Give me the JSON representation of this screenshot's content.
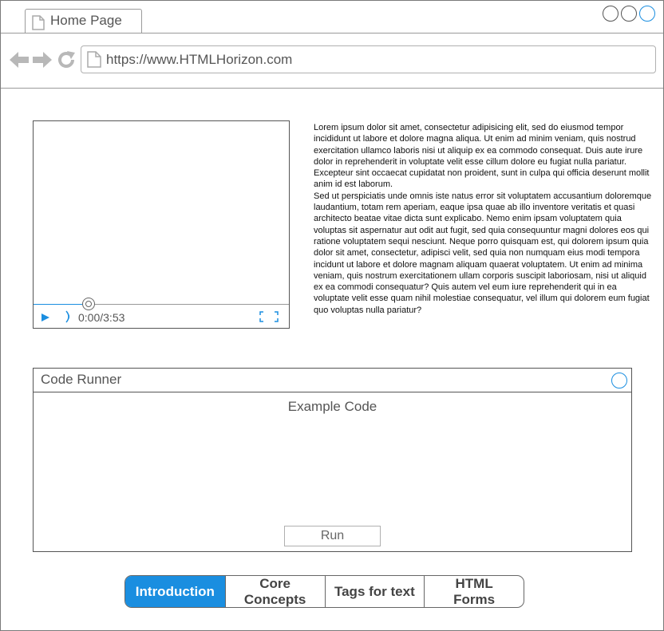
{
  "browser": {
    "tab_title": "Home Page",
    "url": "https://www.HTMLHorizon.com"
  },
  "video": {
    "time": "0:00/3:53",
    "progress": 0.0
  },
  "content": {
    "paragraph_1": "Lorem ipsum dolor sit amet, consectetur adipisicing elit, sed do eiusmod tempor incididunt ut labore et dolore magna aliqua. Ut enim ad minim veniam, quis nostrud exercitation ullamco laboris nisi ut aliquip ex ea commodo consequat. Duis aute irure dolor in reprehenderit in voluptate velit esse cillum dolore eu fugiat nulla pariatur. Excepteur sint occaecat cupidatat non proident, sunt in culpa qui officia deserunt mollit anim id est laborum.",
    "paragraph_2": "Sed ut perspiciatis unde omnis iste natus error sit voluptatem accusantium doloremque laudantium, totam rem aperiam, eaque ipsa quae ab illo inventore veritatis et quasi architecto beatae vitae dicta sunt explicabo. Nemo enim ipsam voluptatem quia voluptas sit aspernatur aut odit aut fugit, sed quia consequuntur magni dolores eos qui ratione voluptatem sequi nesciunt. Neque porro quisquam est, qui dolorem ipsum quia dolor sit amet, consectetur, adipisci velit, sed quia non numquam eius modi tempora incidunt ut labore et dolore magnam aliquam quaerat voluptatem. Ut enim ad minima veniam, quis nostrum exercitationem ullam corporis suscipit laboriosam, nisi ut aliquid ex ea commodi consequatur? Quis autem vel eum iure reprehenderit qui in ea voluptate velit esse quam nihil molestiae consequatur, vel illum qui dolorem eum fugiat quo voluptas nulla pariatur?"
  },
  "code_runner": {
    "title": "Code Runner",
    "subtitle": "Example Code",
    "run_label": "Run"
  },
  "nav_tabs": [
    {
      "label": "Introduction",
      "active": true
    },
    {
      "label": "Core Concepts",
      "active": false
    },
    {
      "label": "Tags for text",
      "active": false
    },
    {
      "label": "HTML Forms",
      "active": false
    }
  ],
  "colors": {
    "accent": "#1a8ee0",
    "border": "#555555"
  }
}
